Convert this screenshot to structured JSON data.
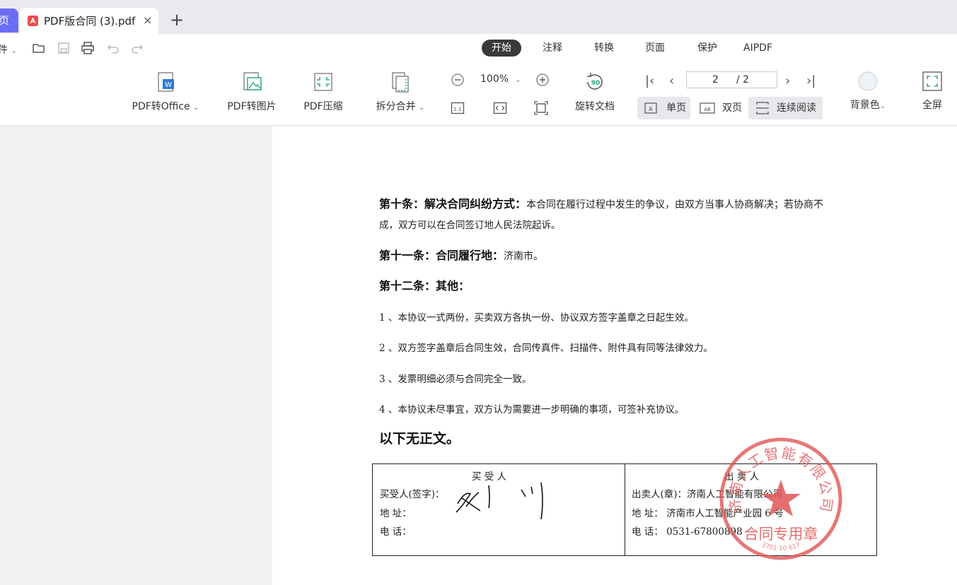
{
  "tabs": {
    "home_label": "页",
    "doc_title": "PDF版合同 (3).pdf",
    "close": "×",
    "new_tab": "+"
  },
  "quick": {
    "file_label": "件"
  },
  "menu": [
    "开始",
    "注释",
    "转换",
    "页面",
    "保护",
    "AIPDF"
  ],
  "tools": {
    "to_office": "PDF转Office",
    "to_image": "PDF转图片",
    "compress": "PDF压缩",
    "split_merge": "拆分合并",
    "zoom": "100%",
    "rotate": "旋转文档",
    "bg_color": "背景色",
    "fullscreen": "全屏"
  },
  "pager": {
    "current": "2",
    "total": "/ 2"
  },
  "views": {
    "single": "单页",
    "double": "双页",
    "continuous": "连续阅读"
  },
  "document": {
    "art10_title": "第十条：解决合同纠纷方式：",
    "art10_text_1": "本合同在履行过程中发生的争议，由双方当事人协商解决；若协商不",
    "art10_text_2": "成，双方可以在合同签订地人民法院起诉。",
    "art11_title": "第十一条：合同履行地：",
    "art11_text": "济南市。",
    "art12_title": "第十二条：其他：",
    "items": [
      "1 、本协议一式两份，买卖双方各执一份、协议双方签字盖章之日起生效。",
      "2 、双方签字盖章后合同生效，合同传真件、扫描件、附件具有同等法律效力。",
      "3 、发票明细必须与合同完全一致。",
      "4 、本协议未尽事宜，双方认为需要进一步明确的事项，可签补充协议。"
    ],
    "end_note": "以下无正文。",
    "buyer": {
      "header": "买  受  人",
      "sign_label": "买受人(签字)：",
      "address_label": "地      址：",
      "phone_label": "电      话："
    },
    "seller": {
      "header": "出  卖  人",
      "seal_label": "出卖人(章)：济南人工智能有限公司",
      "address": "地      址：  济南市人工智能产业园 6 号",
      "phone": "电      话：  0531-67800898"
    },
    "stamp": {
      "company": "济南人工智能有限公司",
      "seal_type": "合同专用章",
      "code": "3701 10 617"
    }
  },
  "colors": {
    "accent": "#6b6ef5",
    "stamp": "#e05555",
    "pdf_red": "#e94b4b"
  }
}
